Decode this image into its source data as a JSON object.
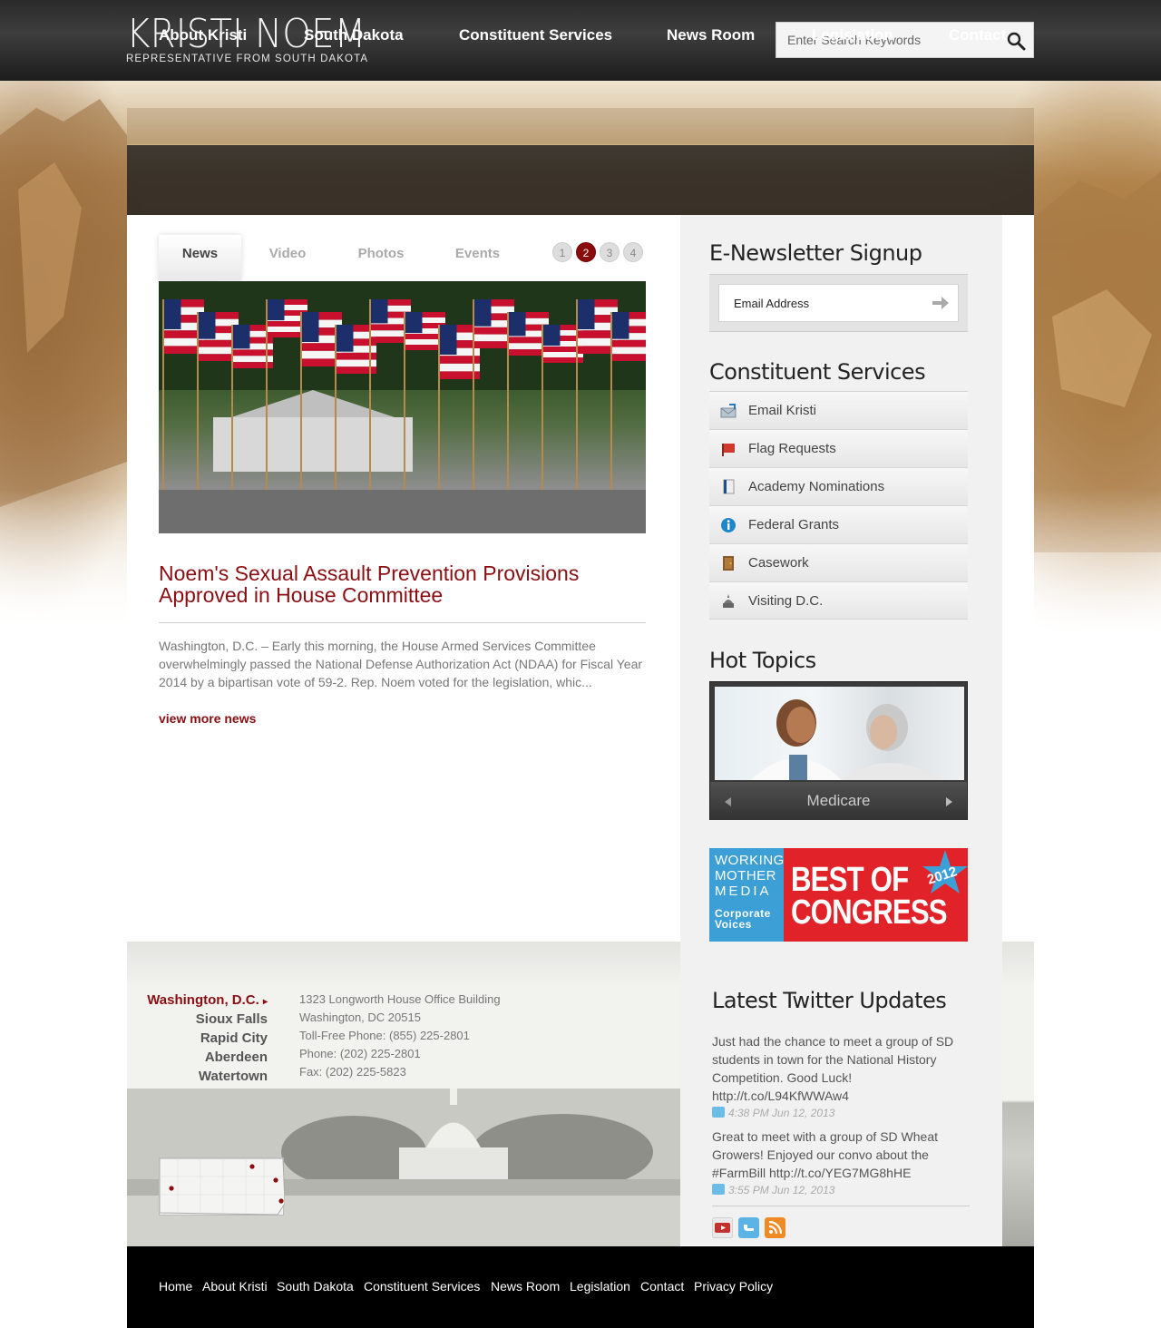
{
  "header": {
    "name": "KRISTI NOEM",
    "subtitle": "REPRESENTATIVE FROM SOUTH DAKOTA",
    "search_placeholder": "Enter Search Keywords"
  },
  "nav": [
    "About Kristi",
    "South Dakota",
    "Constituent Services",
    "News Room",
    "Legislation",
    "Contact"
  ],
  "tabs": {
    "items": [
      "News",
      "Video",
      "Photos",
      "Events"
    ],
    "pager": [
      "1",
      "2",
      "3",
      "4"
    ],
    "active_page": "2"
  },
  "news": {
    "headline": "Noem's Sexual Assault Prevention Provisions Approved in House Committee",
    "excerpt": "Washington, D.C. – Early this morning, the House Armed Services Committee overwhelmingly passed the National Defense Authorization Act (NDAA) for Fiscal Year 2014 by a bipartisan vote of 59-2. Rep. Noem voted for the legislation, whic...",
    "view_more": "view more news"
  },
  "newsletter": {
    "title": "E-Newsletter Signup",
    "placeholder": "Email Address"
  },
  "constituent_services": {
    "title": "Constituent Services",
    "items": [
      {
        "label": "Email Kristi",
        "icon": "envelope-icon"
      },
      {
        "label": "Flag Requests",
        "icon": "flag-icon"
      },
      {
        "label": "Academy Nominations",
        "icon": "book-icon"
      },
      {
        "label": "Federal Grants",
        "icon": "info-icon"
      },
      {
        "label": "Casework",
        "icon": "door-icon"
      },
      {
        "label": "Visiting D.C.",
        "icon": "monument-icon"
      }
    ]
  },
  "hot_topics": {
    "title": "Hot Topics",
    "caption": "Medicare"
  },
  "award": {
    "left_lines": [
      "WORKING",
      "MOTHER",
      "MEDIA",
      "Corporate",
      "Voices"
    ],
    "best": "BEST OF",
    "congress": "CONGRESS",
    "year": "2012"
  },
  "offices": {
    "items": [
      "Washington, D.C.",
      "Sioux Falls",
      "Rapid City",
      "Aberdeen",
      "Watertown"
    ],
    "active_marker": "▸",
    "address_lines": [
      "1323 Longworth House Office Building",
      "Washington, DC 20515",
      "Toll-Free Phone: (855) 225-2801",
      "Phone: (202) 225-2801",
      "Fax: (202) 225-5823"
    ]
  },
  "twitter": {
    "title": "Latest Twitter Updates",
    "tweets": [
      {
        "text": "Just had the chance to meet a group of SD students in town for the National History Competition. Good Luck! http://t.co/L94KfWWAw4",
        "time": "4:38 PM Jun 12, 2013"
      },
      {
        "text": "Great to meet with a group of SD Wheat Growers! Enjoyed our convo about the #FarmBill http://t.co/YEG7MG8hHE",
        "time": "3:55 PM Jun 12, 2013"
      }
    ]
  },
  "social": [
    "youtube-icon",
    "twitter-icon",
    "rss-icon"
  ],
  "footer_links": [
    "Home",
    "About Kristi",
    "South Dakota",
    "Constituent Services",
    "News Room",
    "Legislation",
    "Contact",
    "Privacy Policy"
  ],
  "colors": {
    "accent": "#8a0e12",
    "nav_bg": "#1e1e1e",
    "award_red": "#e12228",
    "award_blue": "#3ca0d6"
  }
}
